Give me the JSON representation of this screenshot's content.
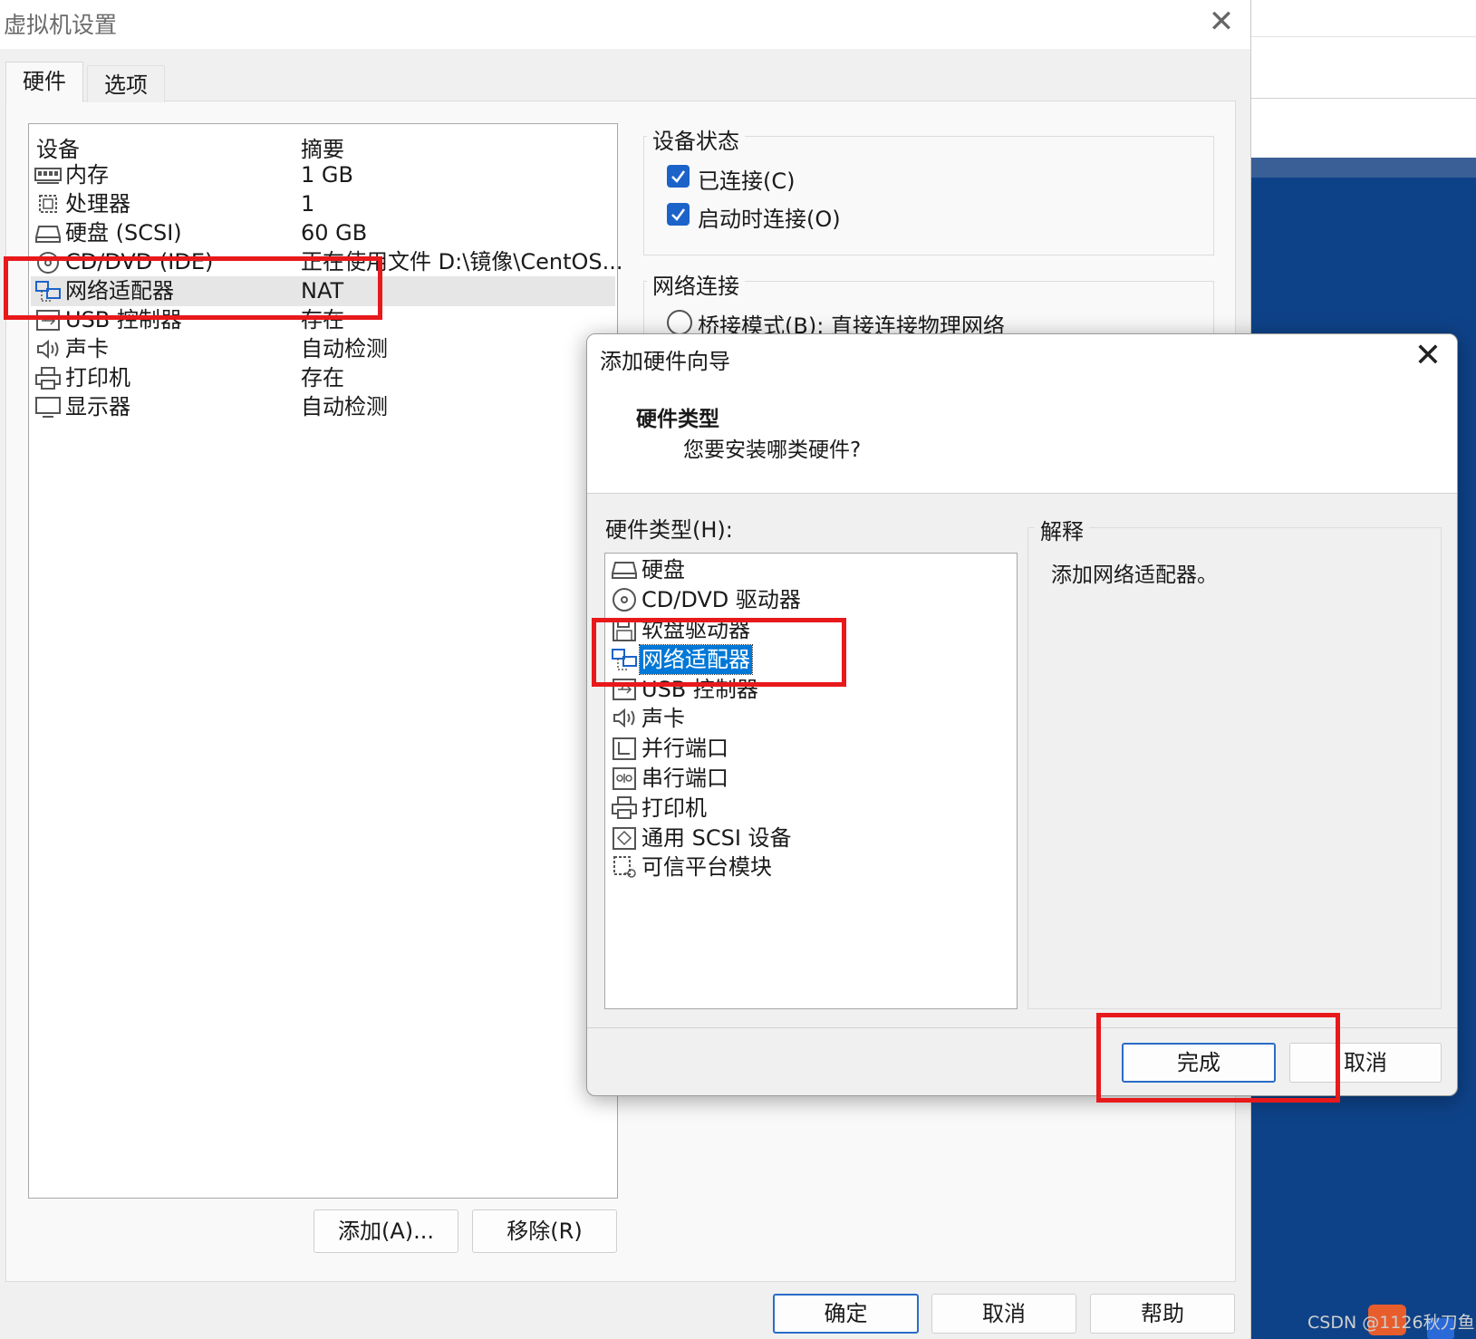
{
  "window": {
    "title": "虚拟机设置"
  },
  "tabs": [
    {
      "label": "硬件"
    },
    {
      "label": "选项"
    }
  ],
  "device_list": {
    "col_device": "设备",
    "col_summary": "摘要",
    "rows": [
      {
        "name": "内存",
        "summary": "1 GB",
        "icon": "memory-icon"
      },
      {
        "name": "处理器",
        "summary": "1",
        "icon": "cpu-icon"
      },
      {
        "name": "硬盘 (SCSI)",
        "summary": "60 GB",
        "icon": "harddisk-icon"
      },
      {
        "name": "CD/DVD (IDE)",
        "summary": "正在使用文件 D:\\镜像\\CentOS...",
        "icon": "cdrom-icon"
      },
      {
        "name": "网络适配器",
        "summary": "NAT",
        "icon": "network-adapter-icon",
        "selected": true
      },
      {
        "name": "USB 控制器",
        "summary": "存在",
        "icon": "usb-icon"
      },
      {
        "name": "声卡",
        "summary": "自动检测",
        "icon": "speaker-icon"
      },
      {
        "name": "打印机",
        "summary": "存在",
        "icon": "printer-icon"
      },
      {
        "name": "显示器",
        "summary": "自动检测",
        "icon": "monitor-icon"
      }
    ]
  },
  "buttons": {
    "add": "添加(A)...",
    "remove": "移除(R)",
    "ok": "确定",
    "cancel": "取消",
    "help": "帮助"
  },
  "device_status": {
    "title": "设备状态",
    "connected": {
      "label": "已连接(C)",
      "checked": true
    },
    "connect_at_power_on": {
      "label": "启动时连接(O)",
      "checked": true
    }
  },
  "network_connection": {
    "title": "网络连接",
    "bridged": {
      "label": "桥接模式(B): 直接连接物理网络",
      "checked": false
    }
  },
  "wizard": {
    "title": "添加硬件向导",
    "heading": "硬件类型",
    "subheading": "您要安装哪类硬件?",
    "list_label": "硬件类型(H):",
    "items": [
      {
        "name": "硬盘",
        "icon": "harddisk-icon"
      },
      {
        "name": "CD/DVD 驱动器",
        "icon": "cdrom-icon"
      },
      {
        "name": "软盘驱动器",
        "icon": "floppy-icon"
      },
      {
        "name": "网络适配器",
        "icon": "network-adapter-icon",
        "selected": true
      },
      {
        "name": "USB 控制器",
        "icon": "usb-icon"
      },
      {
        "name": "声卡",
        "icon": "speaker-icon"
      },
      {
        "name": "并行端口",
        "icon": "parallel-port-icon"
      },
      {
        "name": "串行端口",
        "icon": "serial-port-icon"
      },
      {
        "name": "打印机",
        "icon": "printer-icon"
      },
      {
        "name": "通用 SCSI 设备",
        "icon": "scsi-icon"
      },
      {
        "name": "可信平台模块",
        "icon": "tpm-icon"
      }
    ],
    "explanation_title": "解释",
    "explanation_text": "添加网络适配器。",
    "finish": "完成",
    "cancel": "取消"
  },
  "watermark": {
    "text": "CSDN @1126秋刀鱼"
  },
  "colors": {
    "accent": "#1c63c9",
    "selection": "#0078d7",
    "highlight_box": "#e8191b",
    "background_window": "#0e4288"
  }
}
